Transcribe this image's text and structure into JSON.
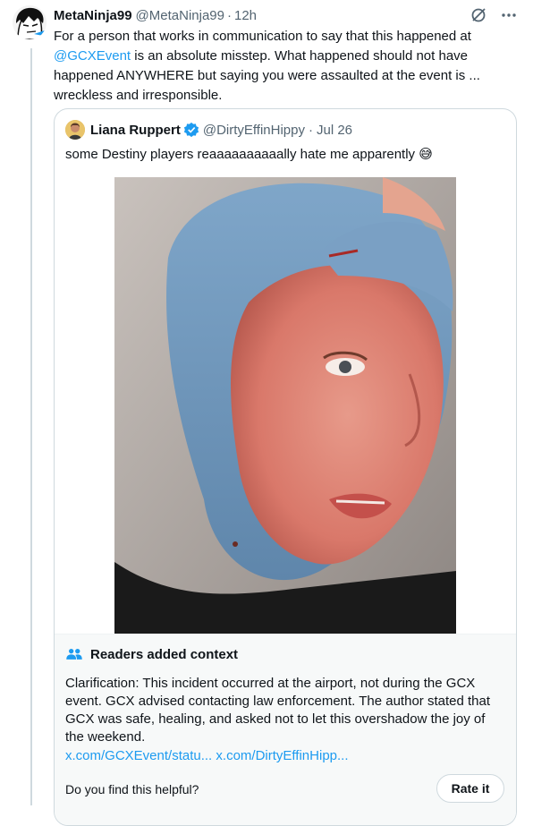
{
  "tweet": {
    "name": "MetaNinja99",
    "handle": "@MetaNinja99",
    "separator": "·",
    "time": "12h",
    "text_parts": {
      "line1": "For a person that works in communication to say that this happened at",
      "mention": "@GCXEvent",
      "rest": " is an absolute misstep.   What happened should not have happened ANYWHERE but saying you were assaulted at the event is ... wreckless and irresponsible."
    }
  },
  "quote": {
    "name": "Liana Ruppert",
    "handle": "@DirtyEffinHippy",
    "separator": "·",
    "date": "Jul 26",
    "text": "some Destiny players reaaaaaaaaaally hate me apparently 😅"
  },
  "context": {
    "title": "Readers added context",
    "body": "Clarification: This incident occurred at the airport, not during the GCX event. GCX advised contacting law enforcement. The author stated that GCX was safe, healing, and asked not to let this overshadow the joy of the weekend.",
    "link1": "x.com/GCXEvent/statu...",
    "link2": "x.com/DirtyEffinHipp...",
    "question": "Do you find this helpful?",
    "rate_label": "Rate it"
  },
  "icons": [
    "grok-icon",
    "more-icon",
    "verified-icon",
    "community-notes-icon"
  ],
  "colors": {
    "accent": "#1d9bf0",
    "muted": "#536471",
    "border": "#cfd9de",
    "note_bg": "#f7f9f9"
  }
}
